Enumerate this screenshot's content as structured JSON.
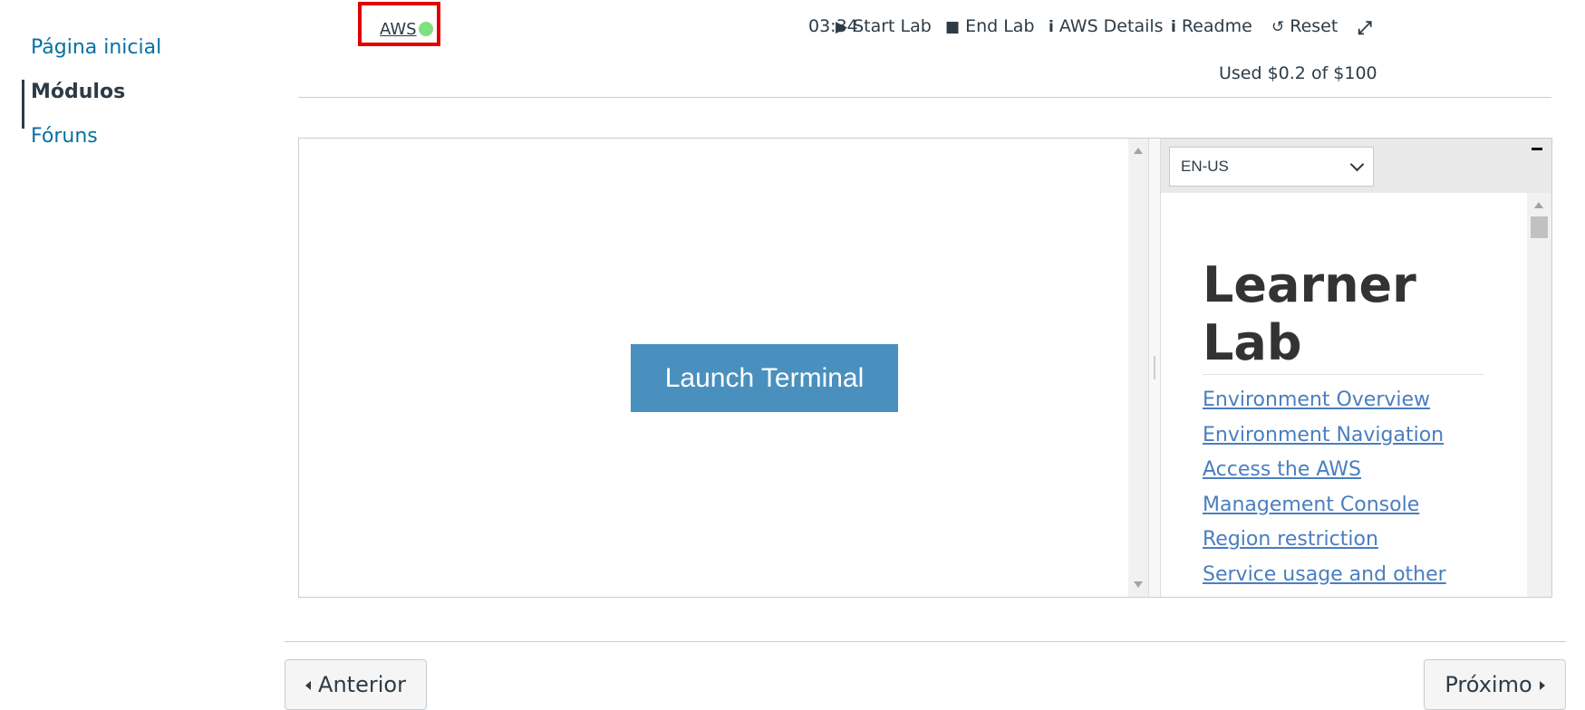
{
  "sidebar": {
    "items": [
      {
        "label": "Página inicial",
        "active": false
      },
      {
        "label": "Módulos",
        "active": true
      },
      {
        "label": "Fóruns",
        "active": false
      }
    ]
  },
  "toolbar": {
    "aws_label": "AWS",
    "aws_status_color": "#7ee27e",
    "timer": "03:34",
    "start_lab": "Start Lab",
    "end_lab": "End Lab",
    "aws_details": "AWS Details",
    "readme": "Readme",
    "reset": "Reset",
    "budget": "Used $0.2 of $100"
  },
  "terminal": {
    "launch_label": "Launch Terminal",
    "button_color": "#4a90bf"
  },
  "readme_panel": {
    "language": "EN-US",
    "title": "Learner Lab",
    "toc": [
      "Environment Overview",
      "Environment Navigation ",
      "Access the AWS ",
      "Management Console ",
      "Region restriction ",
      "Service usage and other"
    ]
  },
  "pager": {
    "previous": "Anterior",
    "next": "Próximo"
  }
}
